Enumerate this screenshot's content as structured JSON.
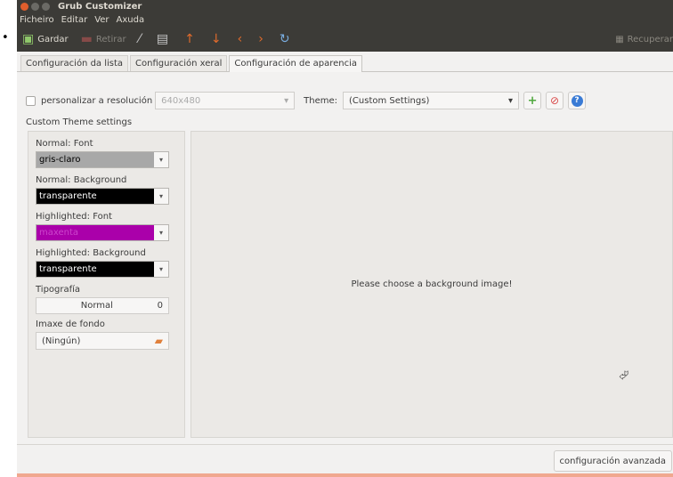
{
  "window": {
    "title": "Grub Customizer"
  },
  "menu": [
    "Ficheiro",
    "Editar",
    "Ver",
    "Axuda"
  ],
  "toolbar": {
    "save": "Gardar",
    "remove": "Retirar",
    "reload": "Recuperar"
  },
  "tabs": [
    "Configuración da lista",
    "Configuración xeral",
    "Configuración de aparencia"
  ],
  "resolution": {
    "label": "personalizar a resolución",
    "value": "640x480"
  },
  "theme": {
    "label": "Theme:",
    "value": "(Custom Settings)"
  },
  "custom": {
    "group_label": "Custom Theme settings",
    "normal_font": {
      "label": "Normal: Font",
      "value": "gris-claro",
      "color": "#a8a8a8",
      "text_color": "#000000"
    },
    "normal_background": {
      "label": "Normal: Background",
      "value": "transparente",
      "color": "#000000",
      "text_color": "#ffffff"
    },
    "highlight_font": {
      "label": "Highlighted: Font",
      "value": "maxenta",
      "color": "#aa00aa",
      "text_color": "#cc44cc"
    },
    "highlight_background": {
      "label": "Highlighted: Background",
      "value": "transparente",
      "color": "#000000",
      "text_color": "#ffffff"
    },
    "typography": {
      "label": "Tipografía",
      "font": "Normal",
      "size": "0"
    },
    "background_image": {
      "label": "Imaxe de fondo",
      "value": "(Ningún)"
    }
  },
  "preview": {
    "message": "Please choose a background image!"
  },
  "advanced_button": "configuración avanzada",
  "bullet": "•"
}
